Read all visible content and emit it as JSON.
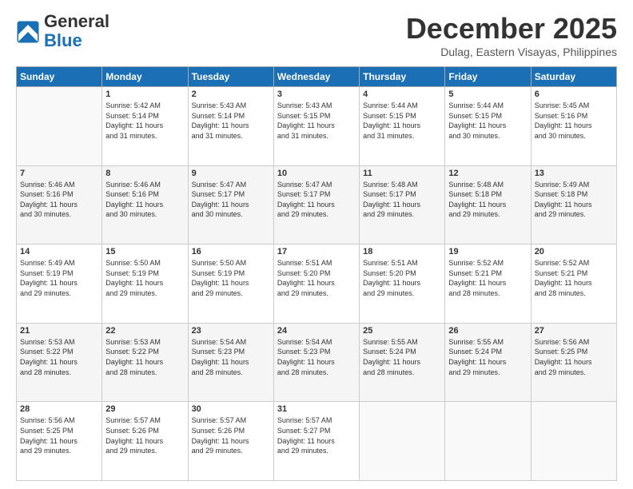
{
  "header": {
    "logo_line1": "General",
    "logo_line2": "Blue",
    "month": "December 2025",
    "location": "Dulag, Eastern Visayas, Philippines"
  },
  "weekdays": [
    "Sunday",
    "Monday",
    "Tuesday",
    "Wednesday",
    "Thursday",
    "Friday",
    "Saturday"
  ],
  "weeks": [
    [
      {
        "day": "",
        "info": ""
      },
      {
        "day": "1",
        "info": "Sunrise: 5:42 AM\nSunset: 5:14 PM\nDaylight: 11 hours\nand 31 minutes."
      },
      {
        "day": "2",
        "info": "Sunrise: 5:43 AM\nSunset: 5:14 PM\nDaylight: 11 hours\nand 31 minutes."
      },
      {
        "day": "3",
        "info": "Sunrise: 5:43 AM\nSunset: 5:15 PM\nDaylight: 11 hours\nand 31 minutes."
      },
      {
        "day": "4",
        "info": "Sunrise: 5:44 AM\nSunset: 5:15 PM\nDaylight: 11 hours\nand 31 minutes."
      },
      {
        "day": "5",
        "info": "Sunrise: 5:44 AM\nSunset: 5:15 PM\nDaylight: 11 hours\nand 30 minutes."
      },
      {
        "day": "6",
        "info": "Sunrise: 5:45 AM\nSunset: 5:16 PM\nDaylight: 11 hours\nand 30 minutes."
      }
    ],
    [
      {
        "day": "7",
        "info": "Sunrise: 5:46 AM\nSunset: 5:16 PM\nDaylight: 11 hours\nand 30 minutes."
      },
      {
        "day": "8",
        "info": "Sunrise: 5:46 AM\nSunset: 5:16 PM\nDaylight: 11 hours\nand 30 minutes."
      },
      {
        "day": "9",
        "info": "Sunrise: 5:47 AM\nSunset: 5:17 PM\nDaylight: 11 hours\nand 30 minutes."
      },
      {
        "day": "10",
        "info": "Sunrise: 5:47 AM\nSunset: 5:17 PM\nDaylight: 11 hours\nand 29 minutes."
      },
      {
        "day": "11",
        "info": "Sunrise: 5:48 AM\nSunset: 5:17 PM\nDaylight: 11 hours\nand 29 minutes."
      },
      {
        "day": "12",
        "info": "Sunrise: 5:48 AM\nSunset: 5:18 PM\nDaylight: 11 hours\nand 29 minutes."
      },
      {
        "day": "13",
        "info": "Sunrise: 5:49 AM\nSunset: 5:18 PM\nDaylight: 11 hours\nand 29 minutes."
      }
    ],
    [
      {
        "day": "14",
        "info": "Sunrise: 5:49 AM\nSunset: 5:19 PM\nDaylight: 11 hours\nand 29 minutes."
      },
      {
        "day": "15",
        "info": "Sunrise: 5:50 AM\nSunset: 5:19 PM\nDaylight: 11 hours\nand 29 minutes."
      },
      {
        "day": "16",
        "info": "Sunrise: 5:50 AM\nSunset: 5:19 PM\nDaylight: 11 hours\nand 29 minutes."
      },
      {
        "day": "17",
        "info": "Sunrise: 5:51 AM\nSunset: 5:20 PM\nDaylight: 11 hours\nand 29 minutes."
      },
      {
        "day": "18",
        "info": "Sunrise: 5:51 AM\nSunset: 5:20 PM\nDaylight: 11 hours\nand 29 minutes."
      },
      {
        "day": "19",
        "info": "Sunrise: 5:52 AM\nSunset: 5:21 PM\nDaylight: 11 hours\nand 28 minutes."
      },
      {
        "day": "20",
        "info": "Sunrise: 5:52 AM\nSunset: 5:21 PM\nDaylight: 11 hours\nand 28 minutes."
      }
    ],
    [
      {
        "day": "21",
        "info": "Sunrise: 5:53 AM\nSunset: 5:22 PM\nDaylight: 11 hours\nand 28 minutes."
      },
      {
        "day": "22",
        "info": "Sunrise: 5:53 AM\nSunset: 5:22 PM\nDaylight: 11 hours\nand 28 minutes."
      },
      {
        "day": "23",
        "info": "Sunrise: 5:54 AM\nSunset: 5:23 PM\nDaylight: 11 hours\nand 28 minutes."
      },
      {
        "day": "24",
        "info": "Sunrise: 5:54 AM\nSunset: 5:23 PM\nDaylight: 11 hours\nand 28 minutes."
      },
      {
        "day": "25",
        "info": "Sunrise: 5:55 AM\nSunset: 5:24 PM\nDaylight: 11 hours\nand 28 minutes."
      },
      {
        "day": "26",
        "info": "Sunrise: 5:55 AM\nSunset: 5:24 PM\nDaylight: 11 hours\nand 29 minutes."
      },
      {
        "day": "27",
        "info": "Sunrise: 5:56 AM\nSunset: 5:25 PM\nDaylight: 11 hours\nand 29 minutes."
      }
    ],
    [
      {
        "day": "28",
        "info": "Sunrise: 5:56 AM\nSunset: 5:25 PM\nDaylight: 11 hours\nand 29 minutes."
      },
      {
        "day": "29",
        "info": "Sunrise: 5:57 AM\nSunset: 5:26 PM\nDaylight: 11 hours\nand 29 minutes."
      },
      {
        "day": "30",
        "info": "Sunrise: 5:57 AM\nSunset: 5:26 PM\nDaylight: 11 hours\nand 29 minutes."
      },
      {
        "day": "31",
        "info": "Sunrise: 5:57 AM\nSunset: 5:27 PM\nDaylight: 11 hours\nand 29 minutes."
      },
      {
        "day": "",
        "info": ""
      },
      {
        "day": "",
        "info": ""
      },
      {
        "day": "",
        "info": ""
      }
    ]
  ]
}
